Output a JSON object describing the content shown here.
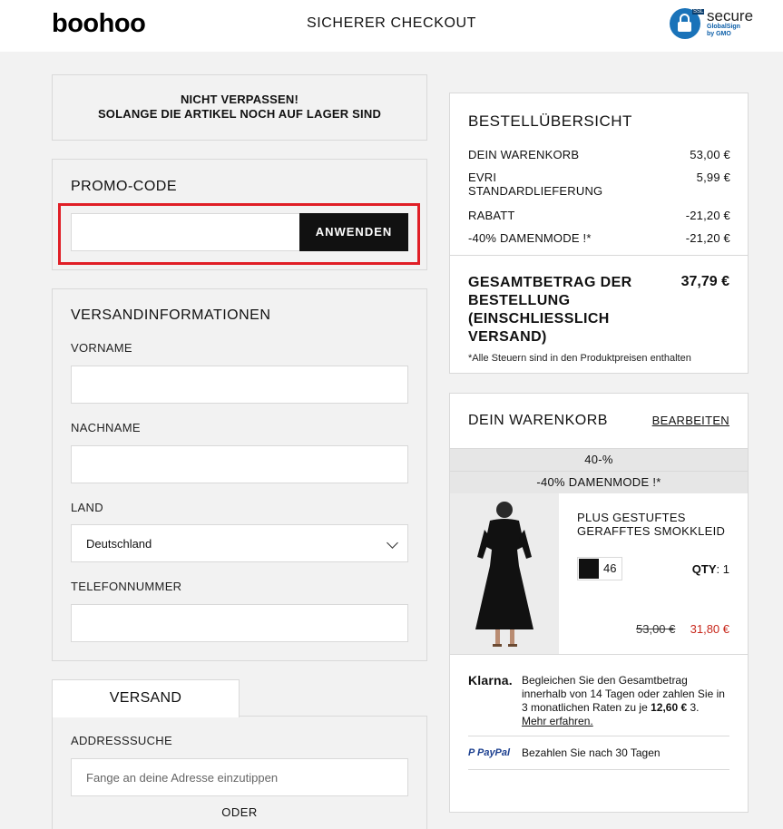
{
  "header": {
    "logo": "boohoo",
    "title": "SICHERER CHECKOUT",
    "badge": {
      "word": "secure",
      "sub1": "GlobalSign",
      "sub2": "by GMO",
      "ssl": "SSL"
    }
  },
  "notice": {
    "line1": "NICHT VERPASSEN!",
    "line2": "SOLANGE DIE ARTIKEL NOCH AUF LAGER SIND"
  },
  "promo": {
    "title": "PROMO-CODE",
    "input_value": "",
    "button": "ANWENDEN"
  },
  "shipping": {
    "title": "VERSANDINFORMATIONEN",
    "first_name_label": "VORNAME",
    "last_name_label": "NACHNAME",
    "country_label": "LAND",
    "country_value": "Deutschland",
    "phone_label": "TELEFONNUMMER"
  },
  "delivery": {
    "tab": "VERSAND",
    "address_label": "ADDRESSSUCHE",
    "address_placeholder": "Fange an deine Adresse einzutippen",
    "or": "ODER"
  },
  "summary": {
    "title": "BESTELLÜBERSICHT",
    "rows": [
      {
        "label": "DEIN WARENKORB",
        "value": "53,00 €"
      },
      {
        "label": "EVRI STANDARDLIEFERUNG",
        "value": "5,99 €"
      },
      {
        "label": "RABATT",
        "value": "-21,20 €"
      },
      {
        "label": "-40% DAMENMODE !*",
        "value": "-21,20 €"
      }
    ],
    "total_label": "GESAMTBETRAG DER BESTELLUNG (EINSCHLIESSLICH VERSAND)",
    "total_value": "37,79 €",
    "tax_note": "*Alle Steuern sind in den Produktpreisen enthalten"
  },
  "cart": {
    "title": "DEIN WARENKORB",
    "edit": "BEARBEITEN",
    "promo_band1": "40-%",
    "promo_band2": "-40% DAMENMODE !*",
    "item": {
      "name": "PLUS GESTUFTES GERAFFTES SMOKKLEID",
      "size": "46",
      "qty_label": "QTY",
      "qty_value": ": 1",
      "old_price": "53,00 €",
      "new_price": "31,80 €"
    },
    "klarna": {
      "logo": "Klarna.",
      "text_pre": "Begleichen Sie den Gesamtbetrag innerhalb von 14 Tagen oder zahlen Sie in 3 monatlichen Raten zu je ",
      "amount": "12,60 €",
      "text_post": " 3.",
      "link": "Mehr erfahren."
    },
    "paypal": {
      "logo": "P PayPal",
      "text": "Bezahlen Sie nach 30 Tagen"
    }
  },
  "colors": {
    "accent": "#111111",
    "highlight": "#e01e26",
    "sale": "#c8281c",
    "paypal": "#1b3f8f"
  }
}
